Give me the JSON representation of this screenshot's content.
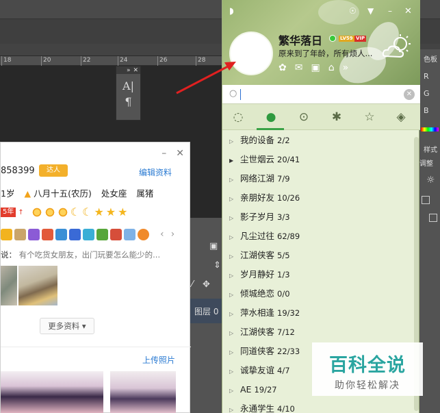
{
  "ps": {
    "ruler_ticks": [
      "18",
      "20",
      "22",
      "24",
      "26",
      "28"
    ],
    "char_panel_glyph1": "A|",
    "char_panel_glyph2": "¶",
    "layer_label": "图层 0",
    "right_labels": [
      "色板",
      "R",
      "G",
      "B",
      "样式",
      "调整"
    ]
  },
  "profile": {
    "qq_number": "858399",
    "badge": "达人",
    "edit_link": "编辑资料",
    "age": "1岁",
    "birthday": "八月十五(农历)",
    "zodiac": "处女座",
    "chinese_zodiac": "属猪",
    "years_badge": "5年",
    "signature_key": "说：",
    "signature": "有个吃货女朋友，出门玩要怎么能少的...",
    "more_button": "更多资料 ▾",
    "upload_link": "上传照片",
    "nav_prev": "‹",
    "nav_next": "›"
  },
  "qq": {
    "nickname": "繁华落日",
    "level_badge": "LV59",
    "vip_badge": "VIP",
    "status_text": "原来到了年龄，所有烦人...",
    "search_placeholder": "",
    "groups": [
      {
        "name": "我的设备",
        "count": "2/2",
        "expanded": false
      },
      {
        "name": "尘世烟云",
        "count": "20/41",
        "expanded": true
      },
      {
        "name": "网络江湖",
        "count": "7/9",
        "expanded": false
      },
      {
        "name": "亲朋好友",
        "count": "10/26",
        "expanded": false
      },
      {
        "name": "影子岁月",
        "count": "3/3",
        "expanded": false
      },
      {
        "name": "凡尘过往",
        "count": "62/89",
        "expanded": false
      },
      {
        "name": "江湖侠客",
        "count": "5/5",
        "expanded": false
      },
      {
        "name": "岁月静好",
        "count": "1/3",
        "expanded": false
      },
      {
        "name": "倾城绝恋",
        "count": "0/0",
        "expanded": false
      },
      {
        "name": "萍水相逢",
        "count": "19/32",
        "expanded": false
      },
      {
        "name": "江湖侠客",
        "count": "7/12",
        "expanded": false
      },
      {
        "name": "同道侠客",
        "count": "22/33",
        "expanded": false
      },
      {
        "name": "诚挚友谊",
        "count": "4/7",
        "expanded": false
      },
      {
        "name": "AE",
        "count": "19/27",
        "expanded": false
      },
      {
        "name": "永通学生",
        "count": "4/10",
        "expanded": false
      }
    ]
  },
  "watermark": {
    "main": "百科全说",
    "sub": "助你轻松解决"
  },
  "colors": {
    "qq_header": "#a6bd80",
    "qq_list_bg": "#e8f0d8",
    "link_blue": "#2a7ad2",
    "annotation_red": "#e02020",
    "watermark_teal": "#2aa5a0"
  }
}
